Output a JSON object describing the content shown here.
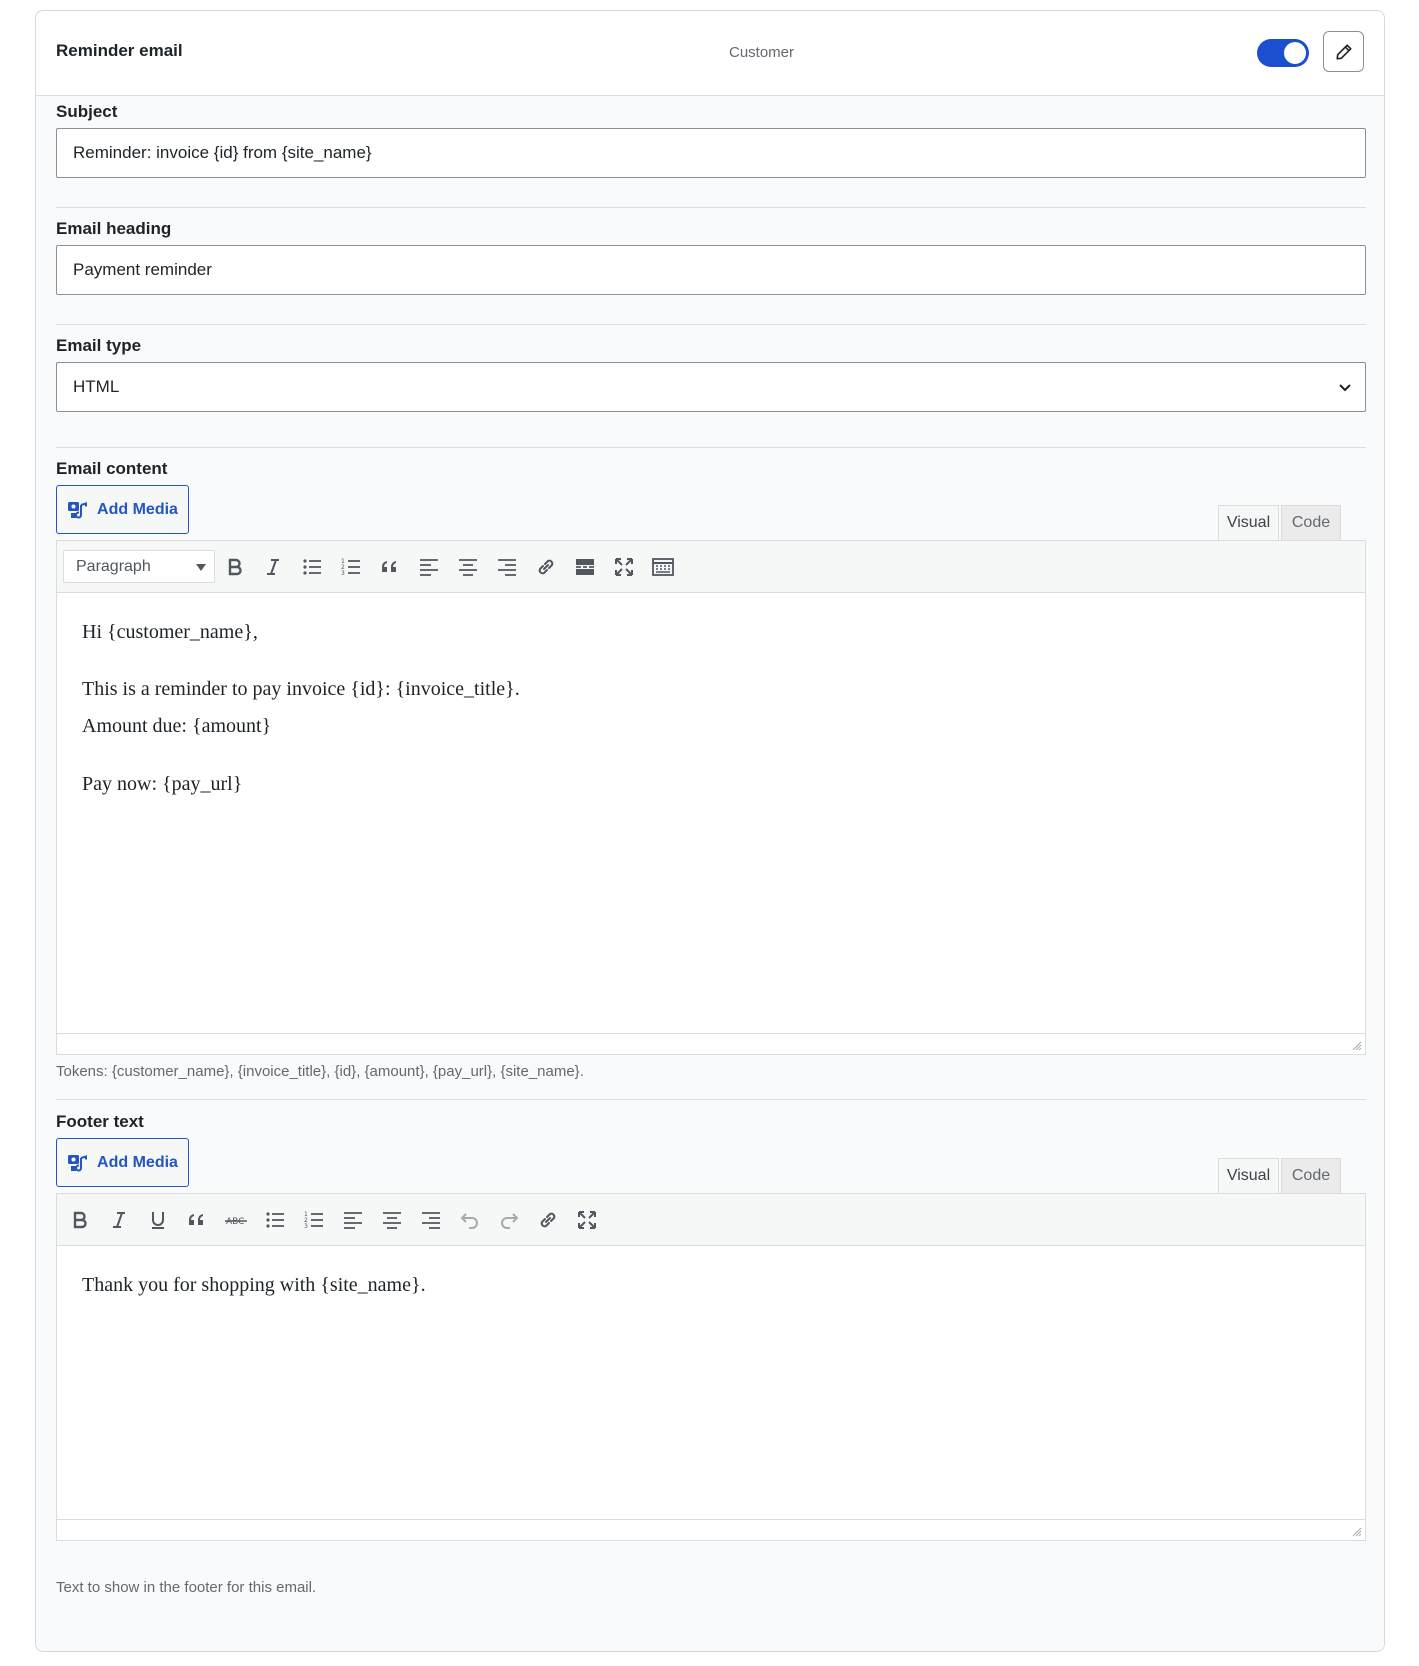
{
  "header": {
    "title": "Reminder email",
    "recipient": "Customer",
    "enabled": true
  },
  "subject": {
    "label": "Subject",
    "value": "Reminder: invoice {id} from {site_name}"
  },
  "heading": {
    "label": "Email heading",
    "value": "Payment reminder"
  },
  "email_type": {
    "label": "Email type",
    "selected": "HTML"
  },
  "content": {
    "label": "Email content",
    "add_media": "Add Media",
    "tab_visual": "Visual",
    "tab_code": "Code",
    "format_select": "Paragraph",
    "toolbar_icons": [
      "bold-icon",
      "italic-icon",
      "bullet-list-icon",
      "numbered-list-icon",
      "blockquote-icon",
      "align-left-icon",
      "align-center-icon",
      "align-right-icon",
      "link-icon",
      "read-more-icon",
      "fullscreen-icon",
      "toolbar-toggle-icon"
    ],
    "lines": [
      "Hi {customer_name},",
      "This is a reminder to pay invoice {id}: {invoice_title}.",
      "Amount due: {amount}",
      "Pay now: {pay_url}"
    ],
    "help": "Tokens: {customer_name}, {invoice_title}, {id}, {amount}, {pay_url}, {site_name}."
  },
  "footer": {
    "label": "Footer text",
    "add_media": "Add Media",
    "tab_visual": "Visual",
    "tab_code": "Code",
    "toolbar_icons": [
      "bold-icon",
      "italic-icon",
      "underline-icon",
      "blockquote-icon",
      "strikethrough-icon",
      "bullet-list-icon",
      "numbered-list-icon",
      "align-left-icon",
      "align-center-icon",
      "align-right-icon",
      "undo-icon",
      "redo-icon",
      "link-icon",
      "fullscreen-icon"
    ],
    "lines": [
      "Thank you for shopping with {site_name}."
    ],
    "help": "Text to show in the footer for this email."
  },
  "colors": {
    "accent": "#1b4fd0",
    "link": "#2455c3",
    "border": "#8c8f94",
    "muted_text": "#646970"
  }
}
